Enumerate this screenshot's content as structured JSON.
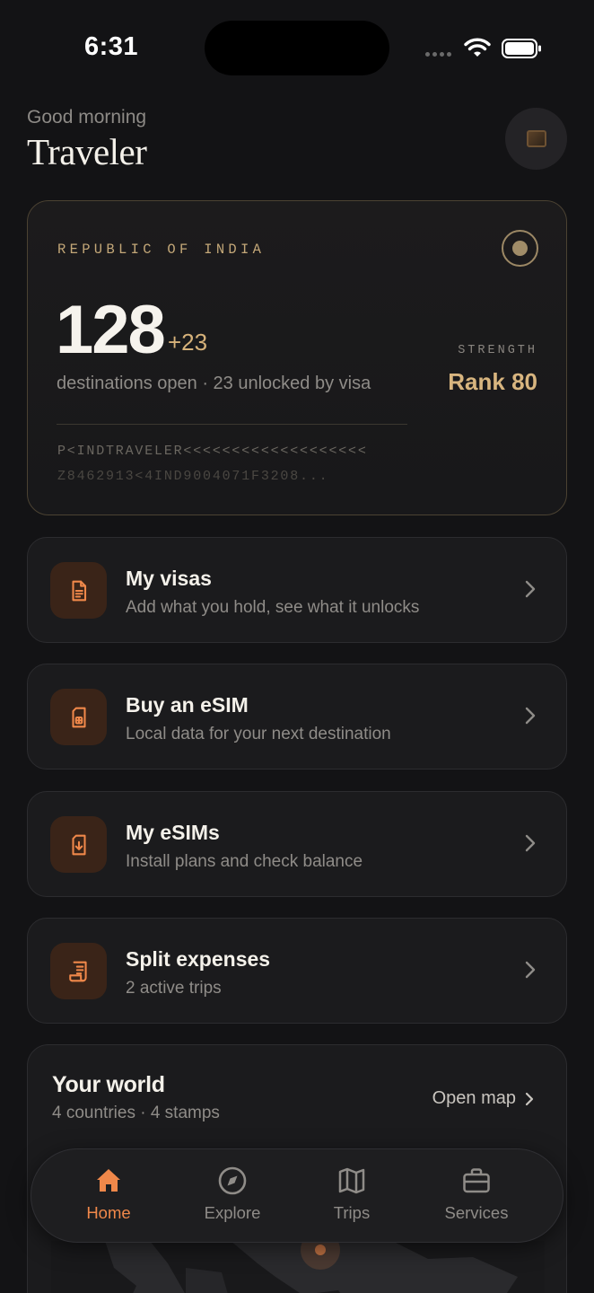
{
  "status_bar": {
    "time": "6:31"
  },
  "header": {
    "greeting": "Good morning",
    "name": "Traveler"
  },
  "passport": {
    "country": "REPUBLIC OF INDIA",
    "count": "128",
    "delta": "+23",
    "description": "destinations open · 23 unlocked by visa",
    "strength_label": "STRENGTH",
    "rank": "Rank 80",
    "mrz_line1": "P<INDTRAVELER<<<<<<<<<<<<<<<<<<<",
    "mrz_line2": "Z8462913<4IND9004071F3208..."
  },
  "menu": [
    {
      "title": "My visas",
      "subtitle": "Add what you hold, see what it unlocks",
      "icon": "document-icon"
    },
    {
      "title": "Buy an eSIM",
      "subtitle": "Local data for your next destination",
      "icon": "sim-card-icon"
    },
    {
      "title": "My eSIMs",
      "subtitle": "Install plans and check balance",
      "icon": "sim-download-icon"
    },
    {
      "title": "Split expenses",
      "subtitle": "2 active trips",
      "icon": "receipt-icon"
    }
  ],
  "world": {
    "title": "Your world",
    "subtitle": "4 countries · 4 stamps",
    "open_map": "Open map"
  },
  "nav": {
    "items": [
      {
        "label": "Home",
        "icon": "home-icon",
        "active": true
      },
      {
        "label": "Explore",
        "icon": "compass-icon",
        "active": false
      },
      {
        "label": "Trips",
        "icon": "map-icon",
        "active": false
      },
      {
        "label": "Services",
        "icon": "briefcase-icon",
        "active": false
      }
    ]
  },
  "colors": {
    "background": "#131315",
    "accent": "#f0884a",
    "gold": "#d8b57f",
    "card": "#1b1b1d"
  }
}
